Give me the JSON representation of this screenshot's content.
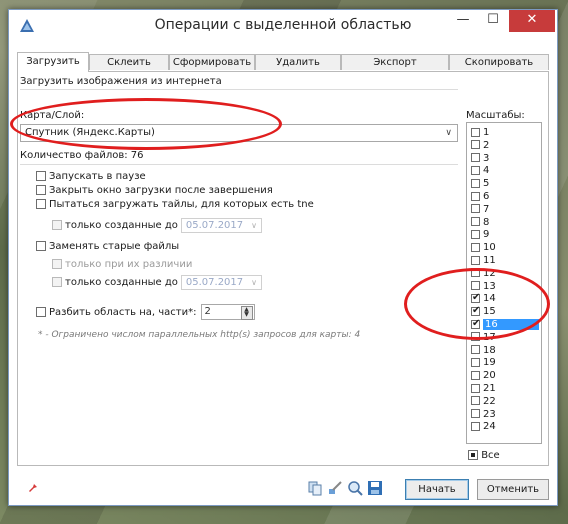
{
  "window": {
    "title": "Операции с выделенной областью"
  },
  "tabs": [
    "Загрузить",
    "Склеить",
    "Сформировать",
    "Удалить",
    "Экспорт",
    "Скопировать"
  ],
  "panel": {
    "subtitle": "Загрузить изображения из интернета",
    "map_label": "Карта/Слой:",
    "map_value": "Спутник (Яндекс.Карты)",
    "file_count": "Количество файлов: 76",
    "options": {
      "start_paused": "Запускать в паузе",
      "close_after": "Закрыть окно загрузки после завершения",
      "try_tne": "Пытаться загружать тайлы, для которых есть tne",
      "only_created_before": "только созданные до",
      "replace_old": "Заменять старые файлы",
      "only_if_differ": "только при их различии",
      "only_created_before_2": "только созданные до",
      "split_area": "Разбить область на, части*:"
    },
    "date1": "05.07.2017",
    "date2": "05.07.2017",
    "split_value": "2",
    "note": "* - Ограничено числом параллельных http(s) запросов для карты: 4"
  },
  "scales": {
    "label": "Масштабы:",
    "items": [
      {
        "n": "1",
        "checked": false
      },
      {
        "n": "2",
        "checked": false
      },
      {
        "n": "3",
        "checked": false
      },
      {
        "n": "4",
        "checked": false
      },
      {
        "n": "5",
        "checked": false
      },
      {
        "n": "6",
        "checked": false
      },
      {
        "n": "7",
        "checked": false
      },
      {
        "n": "8",
        "checked": false
      },
      {
        "n": "9",
        "checked": false
      },
      {
        "n": "10",
        "checked": false
      },
      {
        "n": "11",
        "checked": false
      },
      {
        "n": "12",
        "checked": false
      },
      {
        "n": "13",
        "checked": false
      },
      {
        "n": "14",
        "checked": true
      },
      {
        "n": "15",
        "checked": true
      },
      {
        "n": "16",
        "checked": true,
        "selected": true
      },
      {
        "n": "17",
        "checked": false
      },
      {
        "n": "18",
        "checked": false
      },
      {
        "n": "19",
        "checked": false
      },
      {
        "n": "20",
        "checked": false
      },
      {
        "n": "21",
        "checked": false
      },
      {
        "n": "22",
        "checked": false
      },
      {
        "n": "23",
        "checked": false
      },
      {
        "n": "24",
        "checked": false
      }
    ],
    "all_label": "Все"
  },
  "footer": {
    "start": "Начать",
    "cancel": "Отменить"
  },
  "icons": [
    "app-icon",
    "pin-icon",
    "copy-icon",
    "brush-icon",
    "zoom-icon",
    "save-icon"
  ],
  "colors": {
    "close": "#c73b3b",
    "highlight": "#e01e1e",
    "selection": "#3399ff"
  }
}
